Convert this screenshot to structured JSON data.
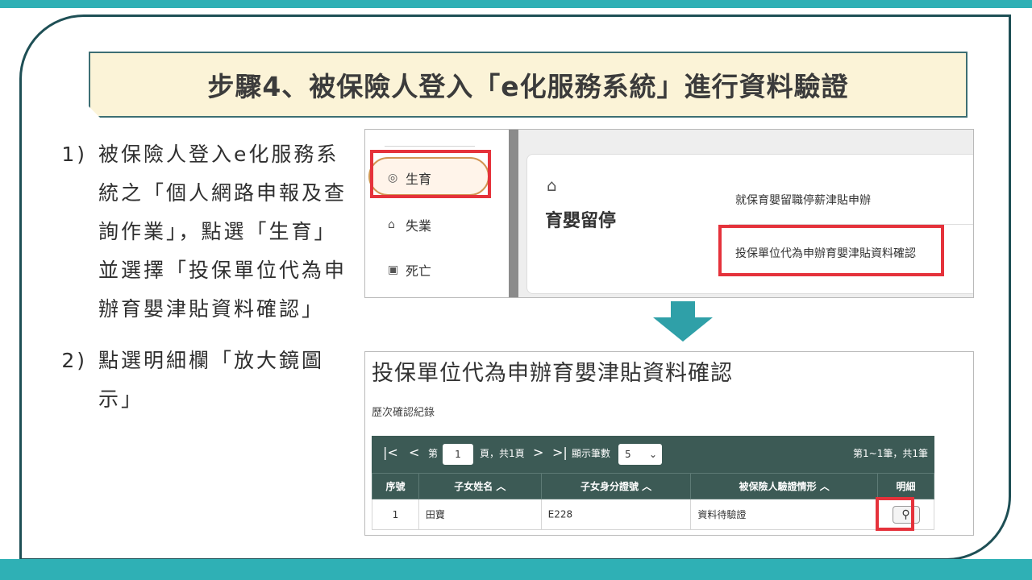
{
  "slide": {
    "title": "步驟4、被保險人登入「e化服務系統」進行資料驗證",
    "steps": [
      {
        "num": "1)",
        "text": "被保險人登入e化服務系統之「個人網路申報及查詢作業」，點選「生育」 並選擇「投保單位代為申辦育嬰津貼資料確認」"
      },
      {
        "num": "2)",
        "text": "點選明細欄「放大鏡圖示」"
      }
    ]
  },
  "shot1": {
    "nav": [
      {
        "label": "生育",
        "icon": "birth-icon",
        "glyph": "◎"
      },
      {
        "label": "失業",
        "icon": "unemployment-icon",
        "glyph": "⌂"
      },
      {
        "label": "死亡",
        "icon": "death-icon",
        "glyph": "▣"
      }
    ],
    "card": {
      "icon": "house-icon",
      "category": "育嬰留停",
      "link1": "就保育嬰留職停薪津貼申辦",
      "link2": "投保單位代為申辦育嬰津貼資料確認"
    }
  },
  "shot2": {
    "title": "投保單位代為申辦育嬰津貼資料確認",
    "subtitle": "歷次確認紀錄",
    "pager": {
      "first": "|<",
      "prev": "<",
      "page_prefix": "第",
      "page_value": "1",
      "page_suffix": "頁，共1頁",
      "next": ">",
      "last": ">|",
      "per_page_label": "顯示筆數",
      "per_page_value": "5",
      "summary": "第1~1筆，共1筆"
    },
    "table": {
      "headers": [
        "序號",
        "子女姓名 ︿",
        "子女身分證號 ︿",
        "被保險人驗證情形 ︿",
        "明細"
      ],
      "rows": [
        {
          "seq": "1",
          "name": "田寶",
          "id": "E228",
          "status": "資料待驗證"
        }
      ]
    }
  },
  "colors": {
    "accent": "#2fb0b5",
    "highlight": "#e5323b",
    "table_header": "#3c5a55",
    "title_bg": "#fbf3d7"
  }
}
